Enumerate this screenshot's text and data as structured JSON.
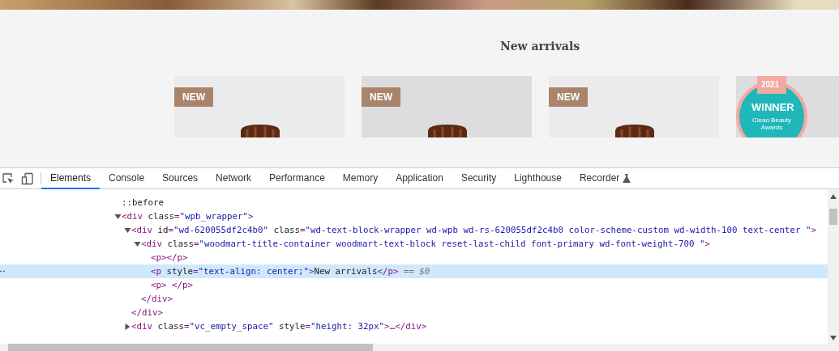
{
  "page": {
    "heading": "New arrivals",
    "products": [
      {
        "kind": "new",
        "badge": "NEW"
      },
      {
        "kind": "new",
        "badge": "NEW"
      },
      {
        "kind": "new",
        "badge": "NEW"
      },
      {
        "kind": "award",
        "year": "2021",
        "title": "WINNER",
        "subtitle": "Clean Beauty Awards"
      }
    ]
  },
  "devtools": {
    "tabs": [
      {
        "label": "Elements",
        "selected": true
      },
      {
        "label": "Console",
        "selected": false
      },
      {
        "label": "Sources",
        "selected": false
      },
      {
        "label": "Network",
        "selected": false
      },
      {
        "label": "Performance",
        "selected": false
      },
      {
        "label": "Memory",
        "selected": false
      },
      {
        "label": "Application",
        "selected": false
      },
      {
        "label": "Security",
        "selected": false
      },
      {
        "label": "Lighthouse",
        "selected": false
      },
      {
        "label": "Recorder",
        "selected": false
      }
    ],
    "dom": [
      {
        "open": "::before",
        "selected": false
      },
      {
        "open": "<div class=\"wpb_wrapper\">",
        "expanded": true,
        "selected": false,
        "children": [
          {
            "open": "<div id=\"wd-620055df2c4b0\" class=\"wd-text-block-wrapper wd-wpb wd-rs-620055df2c4b0 color-scheme-custom wd-width-100 text-center \">",
            "expanded": true,
            "selected": false,
            "close": "</div>",
            "children": [
              {
                "open": "<div class=\"woodmart-title-container woodmart-text-block reset-last-child font-primary wd-font-weight-700 \">",
                "expanded": true,
                "selected": false,
                "close": "</div>",
                "children": [
                  {
                    "open": "<p></p>",
                    "selected": false
                  },
                  {
                    "open": "<p style=\"text-align: center;\">New arrivals</p>",
                    "suffix": "== $0",
                    "selected": true
                  },
                  {
                    "open": "<p> </p>",
                    "selected": false
                  }
                ]
              }
            ]
          },
          {
            "open": "<div class=\"vc_empty_space\" style=\"height: 32px\">…</div>",
            "expanded": false,
            "selected": false
          }
        ]
      }
    ]
  }
}
